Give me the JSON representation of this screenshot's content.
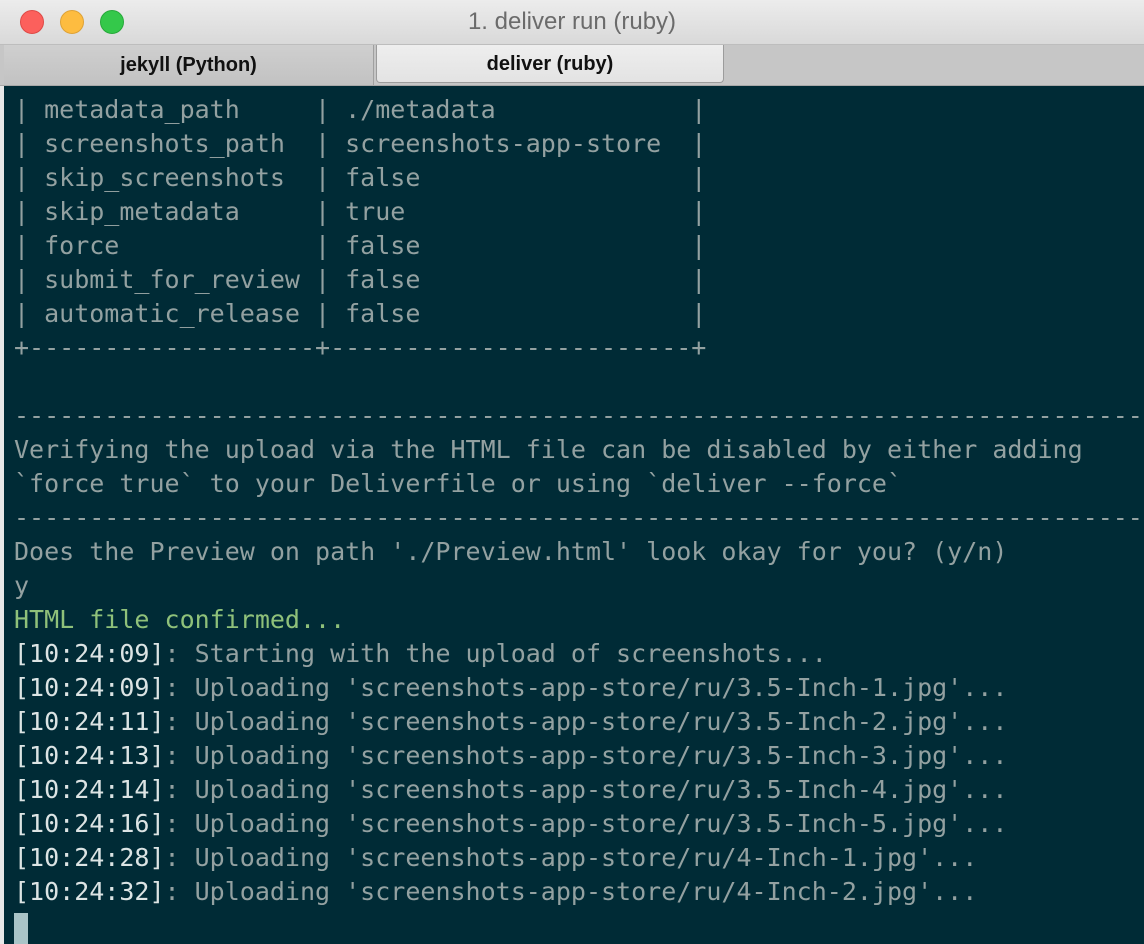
{
  "window": {
    "title": "1. deliver run (ruby)"
  },
  "tabs": [
    {
      "label": "jekyll (Python)",
      "active": false
    },
    {
      "label": "deliver (ruby)",
      "active": true
    }
  ],
  "terminal": {
    "colors": {
      "background": "#002b36",
      "text": "#93a1a1",
      "success": "#8fc17a"
    },
    "lines": [
      {
        "kind": "table",
        "text": "| metadata_path     | ./metadata             |"
      },
      {
        "kind": "table",
        "text": "| screenshots_path  | screenshots-app-store  |"
      },
      {
        "kind": "table",
        "text": "| skip_screenshots  | false                  |"
      },
      {
        "kind": "table",
        "text": "| skip_metadata     | true                   |"
      },
      {
        "kind": "table",
        "text": "| force             | false                  |"
      },
      {
        "kind": "table",
        "text": "| submit_for_review | false                  |"
      },
      {
        "kind": "table",
        "text": "| automatic_release | false                  |"
      },
      {
        "kind": "table",
        "text": "+-------------------+------------------------+"
      },
      {
        "kind": "blank",
        "text": ""
      },
      {
        "kind": "rule",
        "text": "-----------------------------------------------------------------------------"
      },
      {
        "kind": "text",
        "text": "Verifying the upload via the HTML file can be disabled by either adding"
      },
      {
        "kind": "text",
        "text": "`force true` to your Deliverfile or using `deliver --force`"
      },
      {
        "kind": "rule",
        "text": "-----------------------------------------------------------------------------"
      },
      {
        "kind": "prompt",
        "text": "Does the Preview on path './Preview.html' look okay for you? (y/n)"
      },
      {
        "kind": "input",
        "text": "y"
      },
      {
        "kind": "success",
        "text": "HTML file confirmed..."
      },
      {
        "kind": "log",
        "time": "[10:24:09]",
        "text": ": Starting with the upload of screenshots..."
      },
      {
        "kind": "log",
        "time": "[10:24:09]",
        "text": ": Uploading 'screenshots-app-store/ru/3.5-Inch-1.jpg'..."
      },
      {
        "kind": "log",
        "time": "[10:24:11]",
        "text": ": Uploading 'screenshots-app-store/ru/3.5-Inch-2.jpg'..."
      },
      {
        "kind": "log",
        "time": "[10:24:13]",
        "text": ": Uploading 'screenshots-app-store/ru/3.5-Inch-3.jpg'..."
      },
      {
        "kind": "log",
        "time": "[10:24:14]",
        "text": ": Uploading 'screenshots-app-store/ru/3.5-Inch-4.jpg'..."
      },
      {
        "kind": "log",
        "time": "[10:24:16]",
        "text": ": Uploading 'screenshots-app-store/ru/3.5-Inch-5.jpg'..."
      },
      {
        "kind": "log",
        "time": "[10:24:28]",
        "text": ": Uploading 'screenshots-app-store/ru/4-Inch-1.jpg'..."
      },
      {
        "kind": "log",
        "time": "[10:24:32]",
        "text": ": Uploading 'screenshots-app-store/ru/4-Inch-2.jpg'..."
      }
    ]
  }
}
